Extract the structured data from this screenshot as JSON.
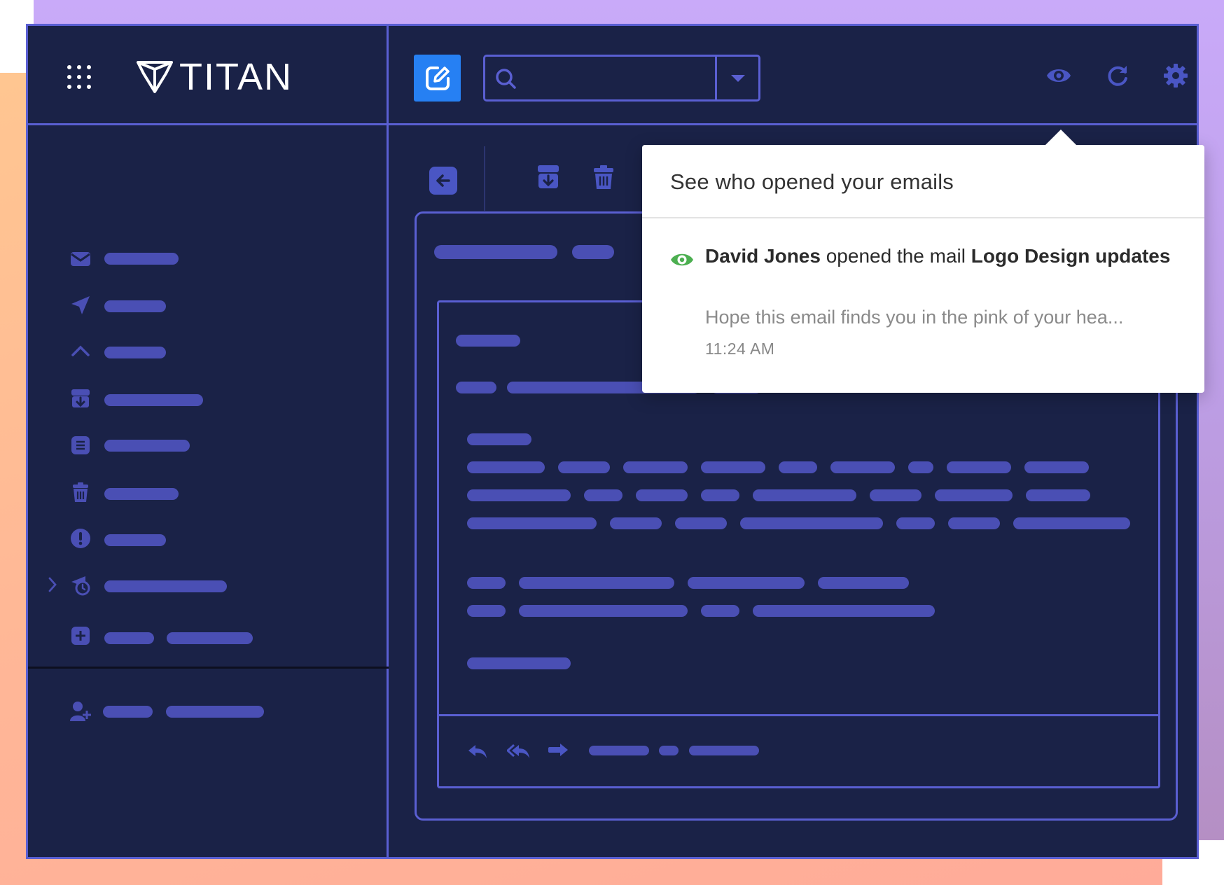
{
  "app": {
    "logo_text": "TITAN"
  },
  "colors": {
    "window_bg": "#1a2247",
    "border": "#5a5fd2",
    "placeholder_bar": "#4a4fb4",
    "compose_btn": "#2680f3",
    "eye_green": "#4caf50"
  },
  "icons": {
    "apps": "apps-grid-icon",
    "logo": "titan-logo-icon",
    "compose": "compose-icon",
    "search": "search-icon",
    "dropdown": "chevron-down-icon",
    "read_receipts": "eye-icon",
    "refresh": "refresh-icon",
    "settings": "gear-icon",
    "back": "back-arrow-icon",
    "archive": "archive-icon",
    "delete": "trash-icon",
    "reply": "reply-icon",
    "reply_all": "reply-all-icon",
    "forward": "forward-icon"
  },
  "sidebar": {
    "items": [
      {
        "icon": "mail-icon"
      },
      {
        "icon": "send-icon"
      },
      {
        "icon": "chevron-up-icon"
      },
      {
        "icon": "archive-icon"
      },
      {
        "icon": "document-icon"
      },
      {
        "icon": "trash-icon"
      },
      {
        "icon": "alert-icon"
      },
      {
        "icon": "alarm-icon"
      },
      {
        "icon": "add-folder-icon"
      },
      {
        "icon": "add-user-icon"
      }
    ]
  },
  "popover": {
    "title": "See who opened your emails",
    "notification": {
      "name": "David Jones",
      "action": " opened the mail ",
      "subject": "Logo Design updates",
      "preview": "Hope this email finds you in the pink of your hea...",
      "time": "11:24 AM"
    }
  }
}
